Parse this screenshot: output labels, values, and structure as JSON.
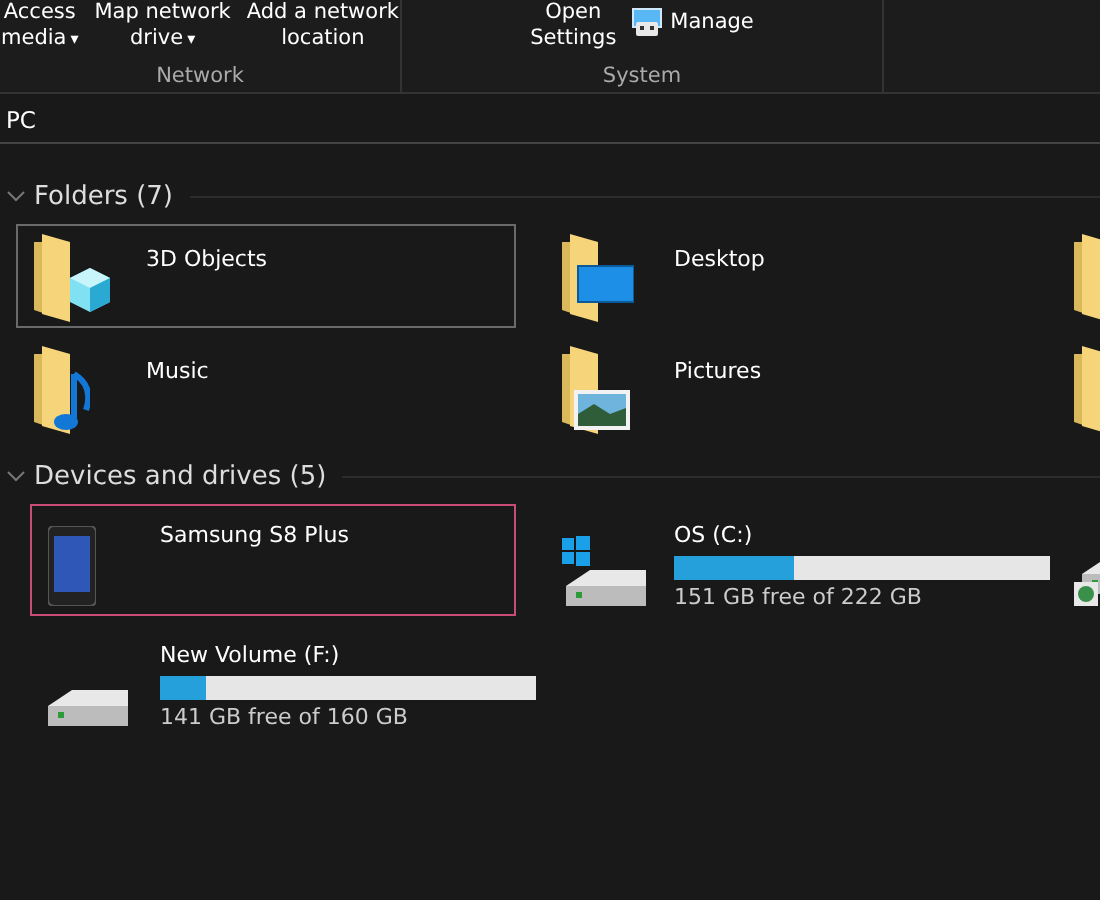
{
  "ribbon": {
    "groups": [
      {
        "label": "Network",
        "buttons": [
          {
            "lines": [
              "Access",
              "media"
            ],
            "dropdown": "▾"
          },
          {
            "lines": [
              "Map network",
              "drive"
            ],
            "dropdown": "▾"
          },
          {
            "lines": [
              "Add a network",
              "location"
            ]
          }
        ]
      },
      {
        "label": "System",
        "buttons": [
          {
            "lines": [
              "Open",
              "Settings"
            ]
          },
          {
            "lines": [
              "Manage"
            ],
            "kind": "manage"
          }
        ]
      }
    ]
  },
  "address": {
    "text": "PC"
  },
  "sections": [
    {
      "title": "Folders (7)",
      "expanded": true,
      "items": [
        {
          "kind": "objects3d",
          "label": "3D Objects",
          "hovered": true,
          "selected": false
        },
        {
          "kind": "desktop",
          "label": "Desktop",
          "hovered": false,
          "selected": false
        },
        {
          "kind": "documents",
          "hovered": false,
          "selected": false
        },
        {
          "kind": "music",
          "label": "Music",
          "hovered": false,
          "selected": false
        },
        {
          "kind": "pictures",
          "label": "Pictures",
          "hovered": false,
          "selected": false
        },
        {
          "kind": "videos",
          "hovered": false,
          "selected": false
        }
      ]
    },
    {
      "title": "Devices and drives (5)",
      "expanded": true,
      "items": [
        {
          "kind": "phone",
          "label": "Samsung S8 Plus",
          "hovered": false,
          "selected": true
        },
        {
          "kind": "osdrive",
          "label": "OS (C:)",
          "level": 0.32,
          "free": "151 GB free of 222 GB",
          "hovered": false,
          "selected": false
        },
        {
          "kind": "netdrive",
          "hovered": false,
          "selected": false
        },
        {
          "kind": "drive",
          "label": "New Volume (F:)",
          "level": 0.12,
          "free": "141 GB free of 160 GB",
          "hovered": false,
          "selected": false
        }
      ]
    }
  ]
}
